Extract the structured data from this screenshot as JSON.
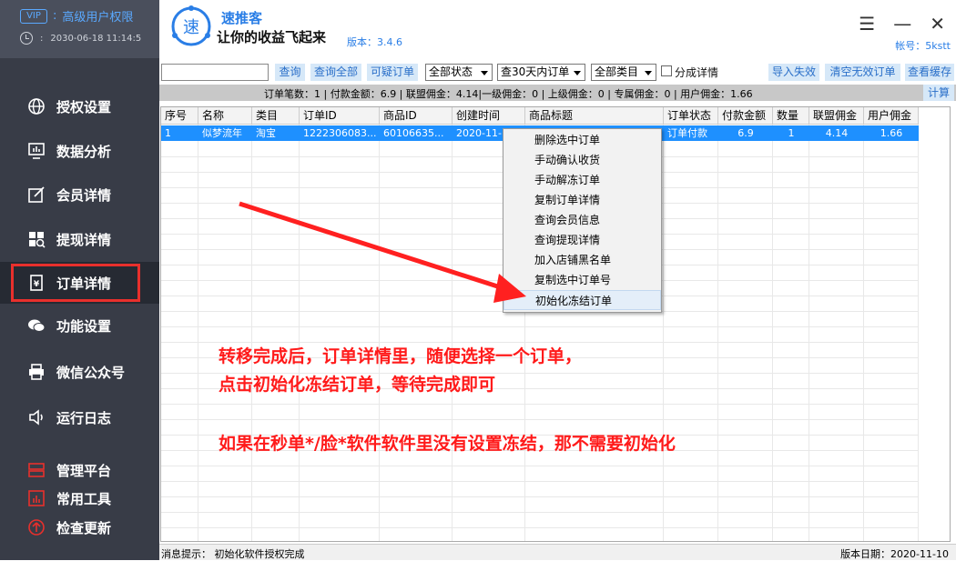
{
  "sidebar": {
    "vip": "VIP",
    "user_level": "高级用户权限",
    "datetime": "2030-06-18 11:14:5",
    "items": [
      {
        "label": "授权设置",
        "icon": "globe-icon"
      },
      {
        "label": "数据分析",
        "icon": "monitor-chart-icon"
      },
      {
        "label": "会员详情",
        "icon": "edit-icon"
      },
      {
        "label": "提现详情",
        "icon": "grid-search-icon"
      },
      {
        "label": "订单详情",
        "icon": "order-yen-icon"
      },
      {
        "label": "功能设置",
        "icon": "chat-icon"
      },
      {
        "label": "微信公众号",
        "icon": "printer-icon"
      },
      {
        "label": "运行日志",
        "icon": "speaker-icon"
      },
      {
        "label": "管理平台",
        "icon": "server-icon"
      },
      {
        "label": "常用工具",
        "icon": "bar-chart-icon"
      },
      {
        "label": "检查更新",
        "icon": "update-icon"
      }
    ]
  },
  "header": {
    "logo_char": "速",
    "brand": "速推客",
    "slogan": "让你的收益飞起来",
    "version": "版本：3.4.6",
    "account": "帐号：5kstt"
  },
  "toolbar": {
    "search_value": "",
    "query": "查询",
    "query_all": "查询全部",
    "suspicious": "可疑订单",
    "status_select": "全部状态",
    "range_select": "查30天内订单",
    "category_select": "全部类目",
    "split_detail": "分成详情",
    "import_fail": "导入失效",
    "clear_invalid": "清空无效订单",
    "view_cache": "查看缓存"
  },
  "stats": {
    "text": "订单笔数：1 | 付款金额：6.9 | 联盟佣金：4.14|一级佣金：0 | 上级佣金：0 | 专属佣金：0 | 用户佣金：1.66",
    "calc": "计算"
  },
  "table": {
    "columns": [
      "序号",
      "名称",
      "类目",
      "订单ID",
      "商品ID",
      "创建时间",
      "商品标题",
      "订单状态",
      "付款金额",
      "数量",
      "联盟佣金",
      "用户佣金"
    ],
    "rows": [
      [
        "1",
        "似梦流年",
        "淘宝",
        "1222306083...",
        "60106635...",
        "2020-11-",
        "",
        "订单付款",
        "6.9",
        "1",
        "4.14",
        "1.66"
      ]
    ]
  },
  "context_menu": [
    "删除选中订单",
    "手动确认收货",
    "手动解冻订单",
    "复制订单详情",
    "查询会员信息",
    "查询提现详情",
    "加入店铺黑名单",
    "复制选中订单号",
    "初始化冻结订单"
  ],
  "annotation": {
    "line1": "转移完成后，订单详情里，随便选择一个订单，",
    "line2": "点击初始化冻结订单，等待完成即可",
    "line3": "如果在秒单*/脸*软件软件里没有设置冻结，那不需要初始化"
  },
  "status": {
    "left": "消息提示：  初始化软件授权完成",
    "right": "版本日期：2020-11-10"
  },
  "colors": {
    "sidebar": "#383c47",
    "accent": "#2a7ee6",
    "selected_row": "#1e90ff",
    "annotation": "#ff1a1a"
  }
}
